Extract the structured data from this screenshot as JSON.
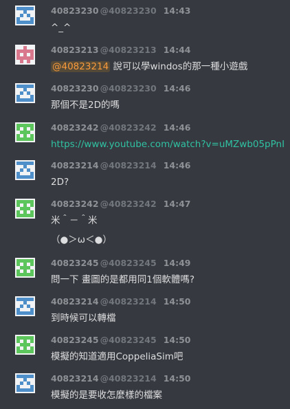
{
  "messages": [
    {
      "name": "40823230",
      "handle": "@40823230",
      "time": "14:43",
      "avatar": {
        "icon": "identicon-blue",
        "color": "#4f8fc9"
      },
      "text": "^_^"
    },
    {
      "name": "40823213",
      "handle": "@40823213",
      "time": "14:44",
      "avatar": {
        "icon": "identicon-red",
        "color": "#d9778c"
      },
      "mention": "@40823214",
      "text": " 說可以學windos的那一種小遊戲"
    },
    {
      "name": "40823230",
      "handle": "@40823230",
      "time": "14:46",
      "avatar": {
        "icon": "identicon-blue",
        "color": "#4f8fc9"
      },
      "text": "那個不是2D的嗎"
    },
    {
      "name": "40823242",
      "handle": "@40823242",
      "time": "14:46",
      "avatar": {
        "icon": "identicon-green",
        "color": "#5cc65c"
      },
      "link": "https://www.youtube.com/watch?v=uMZwb05pPnI"
    },
    {
      "name": "40823214",
      "handle": "@40823214",
      "time": "14:46",
      "avatar": {
        "icon": "identicon-blue",
        "color": "#4f8fc9"
      },
      "text": "2D?"
    },
    {
      "name": "40823242",
      "handle": "@40823242",
      "time": "14:47",
      "avatar": {
        "icon": "identicon-green",
        "color": "#5cc65c"
      },
      "text": "米＾－＾米",
      "text2": "（●＞ω＜●）"
    },
    {
      "name": "40823245",
      "handle": "@40823245",
      "time": "14:49",
      "avatar": {
        "icon": "identicon-green",
        "color": "#5cc65c"
      },
      "text": "問一下 畫圖的是都用同1個軟體嗎?"
    },
    {
      "name": "40823214",
      "handle": "@40823214",
      "time": "14:50",
      "avatar": {
        "icon": "identicon-blue",
        "color": "#4f8fc9"
      },
      "text": "到時候可以轉檔"
    },
    {
      "name": "40823245",
      "handle": "@40823245",
      "time": "14:50",
      "avatar": {
        "icon": "identicon-green",
        "color": "#5cc65c"
      },
      "text": "模擬的知道適用CoppeliaSim吧"
    },
    {
      "name": "40823214",
      "handle": "@40823214",
      "time": "14:50",
      "avatar": {
        "icon": "identicon-blue",
        "color": "#4f8fc9"
      },
      "text": "模擬的是要收怎麼樣的檔案"
    }
  ]
}
